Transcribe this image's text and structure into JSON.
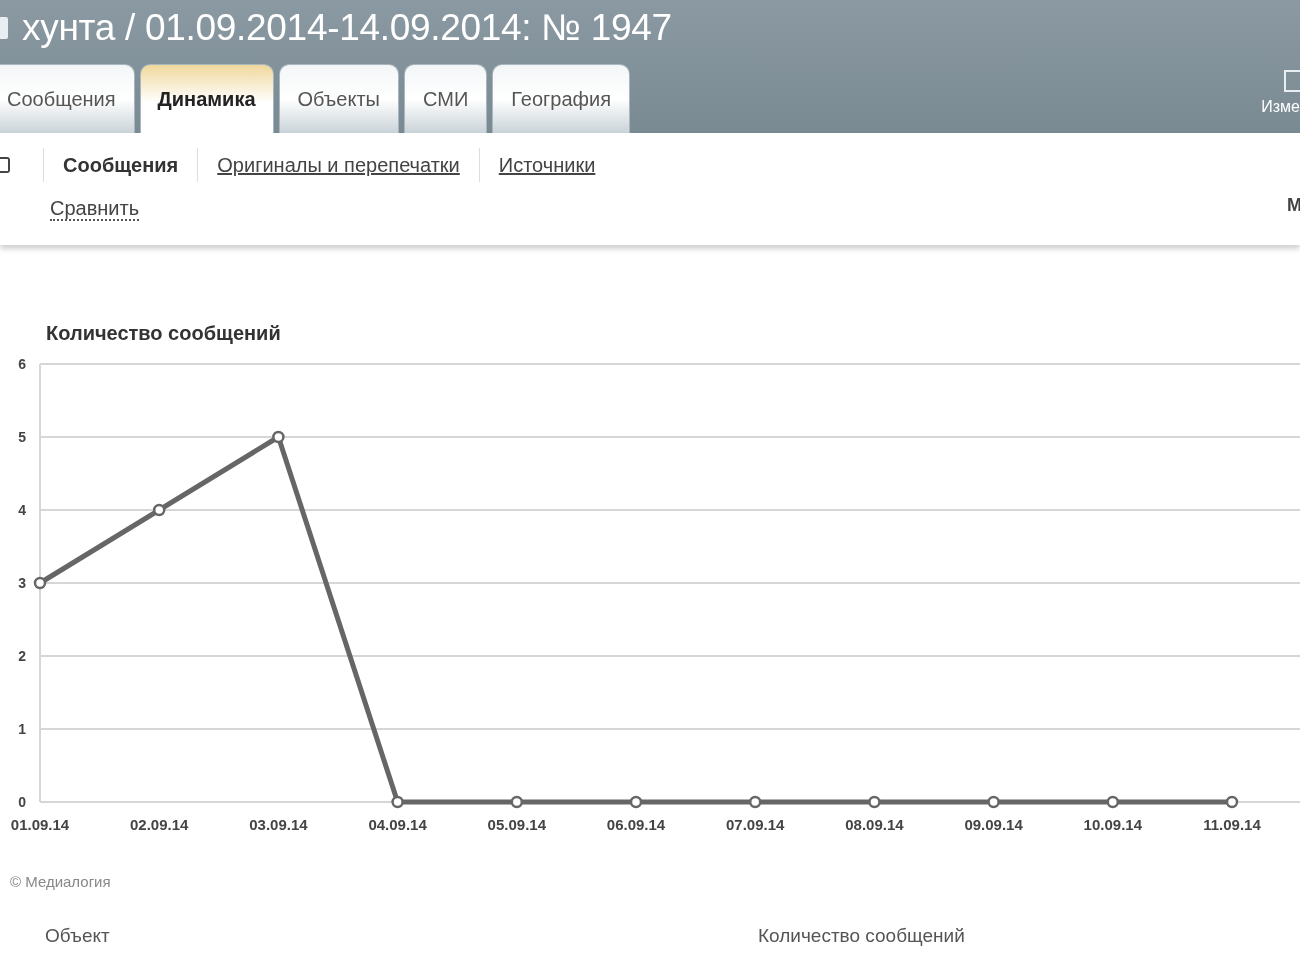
{
  "window": {
    "title": "хунта / 01.09.2014-14.09.2014: № 1947"
  },
  "tabs": [
    {
      "label": "Сообщения",
      "selected": false
    },
    {
      "label": "Динамика",
      "selected": true
    },
    {
      "label": "Объекты",
      "selected": false
    },
    {
      "label": "СМИ",
      "selected": false
    },
    {
      "label": "География",
      "selected": false
    }
  ],
  "header_action": {
    "label": "Изме"
  },
  "subnav": {
    "items": [
      {
        "label": "Сообщения",
        "selected": true
      },
      {
        "label": "Оригиналы и перепечатки",
        "selected": false
      },
      {
        "label": "Источники",
        "selected": false
      }
    ],
    "compare": "Сравнить",
    "right_label": "М"
  },
  "chart": {
    "title": "Количество сообщений",
    "chart_data": {
      "type": "line",
      "categories": [
        "01.09.14",
        "02.09.14",
        "03.09.14",
        "04.09.14",
        "05.09.14",
        "06.09.14",
        "07.09.14",
        "08.09.14",
        "09.09.14",
        "10.09.14",
        "11.09.14"
      ],
      "series": [
        {
          "color": "#666666",
          "marker": "circle",
          "values": [
            3,
            4,
            5,
            0,
            0,
            0,
            0,
            0,
            0,
            0,
            0
          ]
        }
      ],
      "grid": true,
      "ylim": [
        0,
        6
      ],
      "yticks": [
        0,
        1,
        2,
        3,
        4,
        5,
        6
      ]
    }
  },
  "copyright": "© Медиалогия",
  "table": {
    "columns": [
      "Объект",
      "Количество сообщений"
    ]
  }
}
